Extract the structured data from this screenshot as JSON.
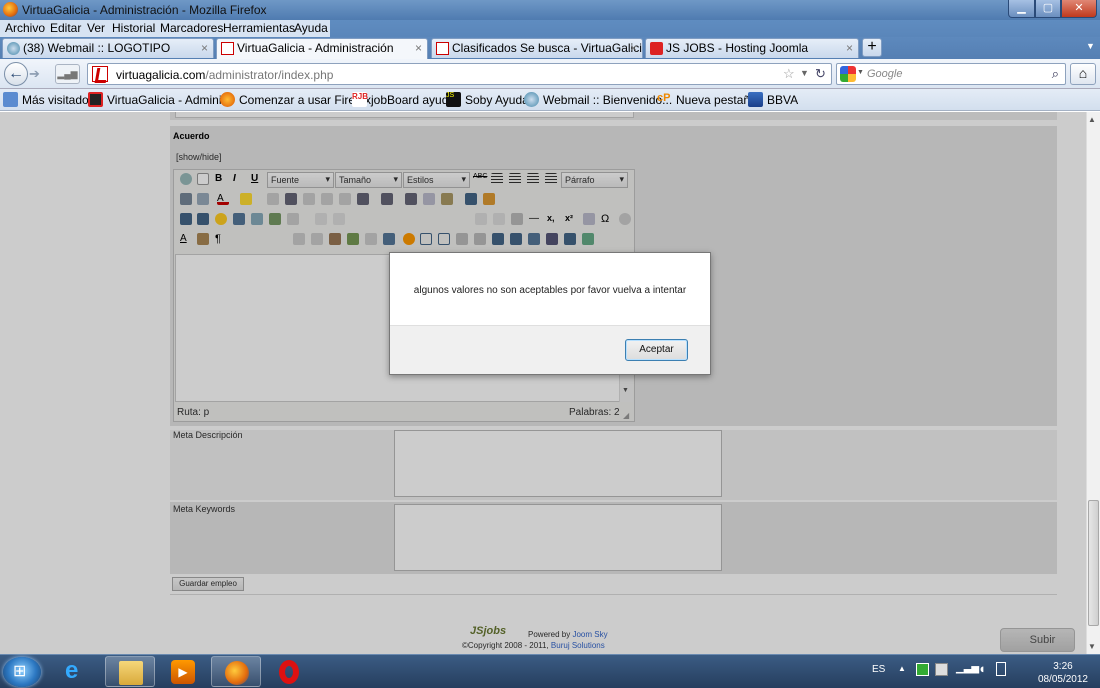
{
  "window": {
    "title": "VirtuaGalicia - Administración - Mozilla Firefox"
  },
  "menu": [
    "Archivo",
    "Editar",
    "Ver",
    "Historial",
    "Marcadores",
    "Herramientas",
    "Ayuda"
  ],
  "tabs": [
    {
      "label": "(38) Webmail :: LOGOTIPO",
      "close": "×"
    },
    {
      "label": "VirtuaGalicia - Administración",
      "close": "×"
    },
    {
      "label": "Clasificados Se busca - VirtuaGalicia",
      "close": "×"
    },
    {
      "label": "JS JOBS - Hosting Joomla",
      "close": "×"
    }
  ],
  "new_tab": "+",
  "nav": {
    "url_domain": "virtuagalicia.com",
    "url_path": "/administrator/index.php",
    "search_placeholder": "Google"
  },
  "bookmarks": [
    "Más visitados",
    "VirtuaGalicia - Admini...",
    "Comenzar a usar Firefox",
    "jobBoard ayuda",
    "Soby Ayuda",
    "Webmail :: Bienvenido...",
    "Nueva pestaña",
    "BBVA"
  ],
  "form": {
    "section_label": "Acuerdo",
    "show_hide": "[show/hide]",
    "toolbar": {
      "font": "Fuente",
      "size": "Tamaño",
      "styles": "Estilos",
      "format": "Párrafo"
    },
    "status_path": "Ruta: p",
    "status_words": "Palabras: 2",
    "meta_description_label": "Meta Descripción",
    "meta_keywords_label": "Meta Keywords",
    "save_button": "Guardar empleo"
  },
  "footer": {
    "logo": "JSjobs",
    "powered_by": "Powered by",
    "powered_link": "Joom Sky",
    "copyright": "©Copyright 2008 - 2011,",
    "copyright_link": "Buruj Solutions",
    "submit": "Subir"
  },
  "dialog": {
    "message": "algunos valores no son aceptables por favor vuelva a intentar",
    "ok": "Aceptar"
  },
  "taskbar": {
    "lang": "ES",
    "time": "3:26",
    "date": "08/05/2012"
  }
}
